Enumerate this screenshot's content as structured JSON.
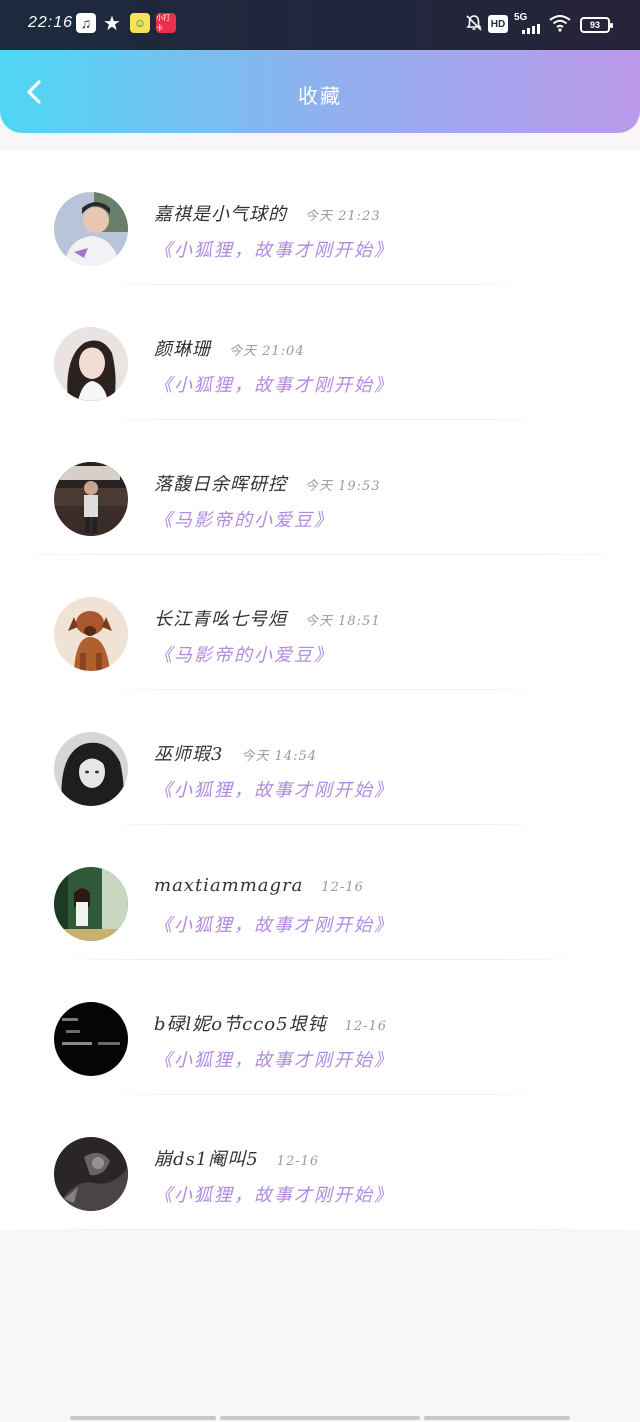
{
  "status_bar": {
    "time": "22:16",
    "network": "5G",
    "hd": "HD",
    "battery": "93",
    "app_badge": "小打卡"
  },
  "header": {
    "title": "收藏",
    "back_icon": "chevron-left-icon",
    "gradient": [
      "#4fd7f3",
      "#bb98ea"
    ]
  },
  "colors": {
    "story_title": "#b28be0",
    "name": "#333333",
    "time": "#999999"
  },
  "favorites": [
    {
      "name": "嘉祺是小气球的",
      "time": "今天 21:23",
      "story": "《小狐狸，故事才刚开始》"
    },
    {
      "name": "颜琳珊",
      "time": "今天 21:04",
      "story": "《小狐狸，故事才刚开始》"
    },
    {
      "name": "落馥日余晖研控",
      "time": "今天 19:53",
      "story": "《马影帝的小爱豆》"
    },
    {
      "name": "长江青吆七号烜",
      "time": "今天 18:51",
      "story": "《马影帝的小爱豆》"
    },
    {
      "name": "巫师瑕3",
      "time": "今天 14:54",
      "story": "《小狐狸，故事才刚开始》"
    },
    {
      "name": "maxtiammagra",
      "time": "12-16",
      "story": "《小狐狸，故事才刚开始》"
    },
    {
      "name": "b碌l妮o节cco5垠钝",
      "time": "12-16",
      "story": "《小狐狸，故事才刚开始》"
    },
    {
      "name": "崩ds1阉叫5",
      "time": "12-16",
      "story": "《小狐狸，故事才刚开始》"
    }
  ]
}
